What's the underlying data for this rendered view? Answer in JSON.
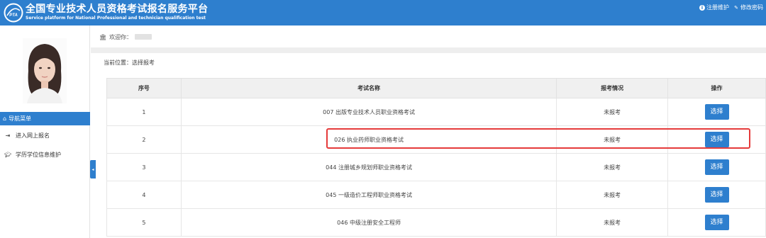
{
  "header": {
    "title": "全国专业技术人员资格考试报名服务平台",
    "subtitle": "Service platform for National Professional and technician qualification test",
    "logo_text": "PTA",
    "links": [
      {
        "icon": "info-icon",
        "label": "注册维护"
      },
      {
        "icon": "edit-icon",
        "label": "修改密码"
      }
    ]
  },
  "sidebar": {
    "menu_header": "导航菜单",
    "items": [
      {
        "icon": "sign-in-icon",
        "label": "进入网上报名"
      },
      {
        "icon": "graduation-cap-icon",
        "label": "学历学位信息维护"
      }
    ]
  },
  "welcome": {
    "label": "欢迎你："
  },
  "breadcrumb": "当前位置：选择报考",
  "table": {
    "headers": [
      "序号",
      "考试名称",
      "报考情况",
      "操作"
    ],
    "rows": [
      {
        "no": "1",
        "name": "007 出版专业技术人员职业资格考试",
        "status": "未报考",
        "action": "选择"
      },
      {
        "no": "2",
        "name": "026 执业药师职业资格考试",
        "status": "未报考",
        "action": "选择"
      },
      {
        "no": "3",
        "name": "044 注册城乡规划师职业资格考试",
        "status": "未报考",
        "action": "选择"
      },
      {
        "no": "4",
        "name": "045 一级造价工程师职业资格考试",
        "status": "未报考",
        "action": "选择"
      },
      {
        "no": "5",
        "name": "046 中级注册安全工程师",
        "status": "未报考",
        "action": "选择"
      }
    ]
  },
  "colors": {
    "primary": "#2e7fce",
    "highlight": "#e53b3b"
  }
}
